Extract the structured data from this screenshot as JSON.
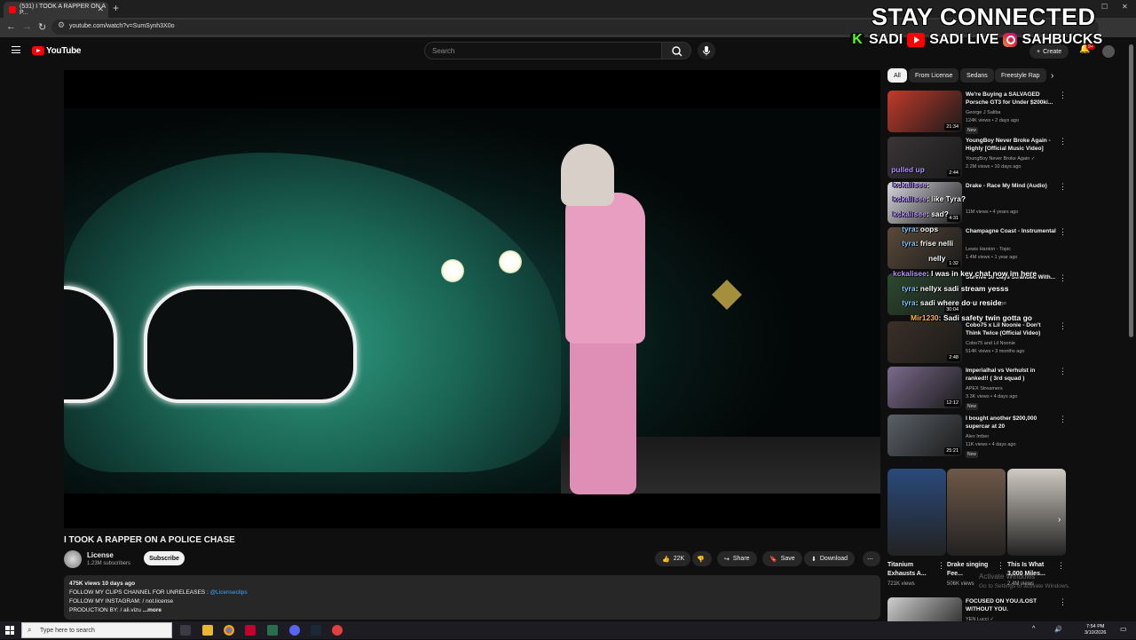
{
  "browser": {
    "tab_title": "(531) I TOOK A RAPPER ON A P...",
    "url": "youtube.com/watch?v=SumSynh3X0o"
  },
  "header": {
    "logo_text": "YouTube",
    "search_placeholder": "Search",
    "create_label": "Create",
    "notif_count": "9+"
  },
  "overlay": {
    "stay": "STAY CONNECTED",
    "kick": "SADI",
    "youtube": "SADI LIVE",
    "instagram": "SAHBUCKS"
  },
  "video": {
    "title": "I TOOK A RAPPER ON A POLICE CHASE",
    "channel": "License",
    "subscribers": "1.23M subscribers",
    "subscribe_label": "Subscribe",
    "likes": "22K",
    "share_label": "Share",
    "save_label": "Save",
    "download_label": "Download"
  },
  "description": {
    "meta": "475K views  10 days ago",
    "line1": "FOLLOW MY CLIPS CHANNEL FOR UNRELEASES :",
    "line1_link": "@Licenseclips",
    "line2": "FOLLOW MY INSTAGRAM:",
    "line2_handle": "/ not.license",
    "line3": "PRODUCTION BY:",
    "line3_handle": "/ ali.vizu",
    "more": "...more"
  },
  "chips": [
    "All",
    "From License",
    "Sedans",
    "Freestyle Rap"
  ],
  "recommendations": [
    {
      "title": "We're Buying a SALVAGED Porsche GT3 for Under $200ki...",
      "channel": "George J Saliba",
      "meta": "124K views • 2 days ago",
      "badge": "New",
      "duration": "21:34",
      "color": "#c23a2a"
    },
    {
      "title": "YoungBoy Never Broke Again - Highly [Official Music Video]",
      "channel": "YoungBoy Never Broke Again ✓",
      "meta": "2.2M views • 10 days ago",
      "badge": "",
      "duration": "2:44",
      "color": "#3a3536"
    },
    {
      "title": "Drake - Race My Mind (Audio)",
      "channel": "",
      "meta": "11M views • 4 years ago",
      "badge": "",
      "duration": "4:31",
      "color": "#d8d8e0"
    },
    {
      "title": "Champagne Coast - Instrumental",
      "channel": "Lewis Hanton - Topic",
      "meta": "1.4M views • 1 year ago",
      "badge": "",
      "duration": "1:32",
      "color": "#5a4a3a"
    },
    {
      "title": "Survive 30 Days Stranded With...",
      "channel": "",
      "meta": "views • 3 days ago",
      "badge": "",
      "duration": "30:04",
      "color": "#2c4a2e"
    },
    {
      "title": "Cobo75 x Lil Noonie - Don't Think Twice (Official Video)",
      "channel": "Cobo75 and Lil Noonie",
      "meta": "514K views • 3 months ago",
      "badge": "",
      "duration": "2:48",
      "color": "#3b3027"
    },
    {
      "title": "Imperialhal vs Verhulst in ranked!! ( 3rd squad )",
      "channel": "APEX Streamers",
      "meta": "3.3K views • 4 days ago",
      "badge": "New",
      "duration": "12:12",
      "color": "#7a6a8c"
    },
    {
      "title": "I bought another $200,000 supercar at 20",
      "channel": "Alex Imber",
      "meta": "11K views • 4 days ago",
      "badge": "New",
      "duration": "25:21",
      "color": "#5b6168"
    },
    {
      "title": "FOCUSED ON YOU./LOST WITHOUT YOU.",
      "channel": "YEN Lucci ✓",
      "meta": "",
      "badge": "",
      "duration": "",
      "color": "#cfcfcf"
    }
  ],
  "chat": [
    {
      "user": "pulled up",
      "text": ""
    },
    {
      "user": "kckalisee",
      "text": ":"
    },
    {
      "user": "kckalisee",
      "text": ": like Tyra?"
    },
    {
      "user": "kckalisee",
      "text": ": sad?"
    },
    {
      "user": "tyra",
      "text": ": oops"
    },
    {
      "user": "tyra",
      "text": ": frise nelli"
    },
    {
      "user": "",
      "text": "nelly"
    },
    {
      "user": "kckalisee",
      "text": ": I was in kev chat now im here"
    },
    {
      "user": "tyra",
      "text": ": nellyx sadi stream yesss"
    },
    {
      "user": "tyra",
      "text": ": sadi where do u reside"
    },
    {
      "user": "Mir1230",
      "text": ": Sadi safety twin gotta go"
    }
  ],
  "shorts": [
    {
      "title": "Titanium Exhausts A...",
      "views": "721K views",
      "color": "#2a4a7a"
    },
    {
      "title": "Drake singing Fee...",
      "views": "506K views",
      "color": "#6e5848"
    },
    {
      "title": "This Is What 3,000 Miles...",
      "views": "2.4M views",
      "color": "#cfcac2"
    }
  ],
  "watermark": {
    "line1": "Activate Windows",
    "line2": "Go to Settings to activate Windows."
  },
  "taskbar": {
    "search_placeholder": "Type here to search",
    "time": "7:54 PM",
    "date": "3/10/2026"
  },
  "colors": {
    "bg": "#0f0f0f",
    "youtube_red": "#ff0000",
    "link": "#3ea6ff"
  }
}
